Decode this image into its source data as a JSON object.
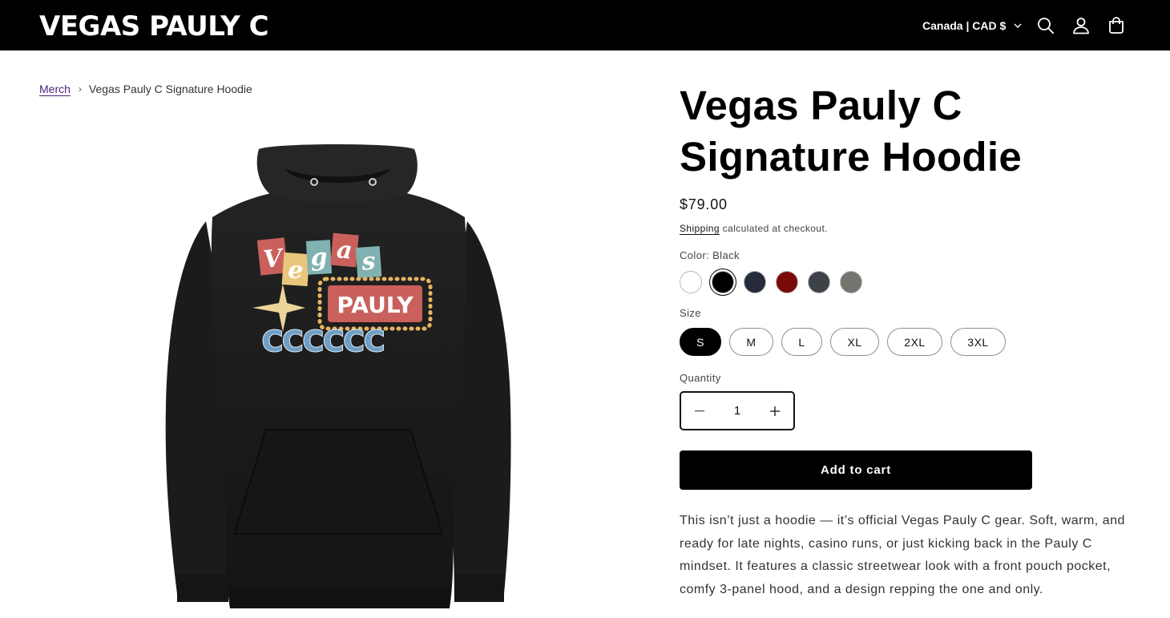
{
  "header": {
    "logo": "VEGAS PAULY C",
    "locale": "Canada | CAD $",
    "icons": [
      "search-icon",
      "account-icon",
      "cart-icon"
    ],
    "background": "#000000"
  },
  "breadcrumb": {
    "parent": "Merch",
    "separator": "›",
    "current": "Vegas Pauly C Signature Hoodie"
  },
  "product": {
    "title": "Vegas Pauly C Signature Hoodie",
    "price": "$79.00",
    "shipping_link": "Shipping",
    "shipping_rest": " calculated at checkout.",
    "color_label": "Color: Black",
    "colors": [
      {
        "name": "White",
        "hex": "#ffffff",
        "selected": false
      },
      {
        "name": "Black",
        "hex": "#000000",
        "selected": true
      },
      {
        "name": "Navy",
        "hex": "#262b3c",
        "selected": false
      },
      {
        "name": "Maroon",
        "hex": "#7a0a0a",
        "selected": false
      },
      {
        "name": "Charcoal",
        "hex": "#3d4249",
        "selected": false
      },
      {
        "name": "Grey",
        "hex": "#73756f",
        "selected": false
      }
    ],
    "size_label": "Size",
    "sizes": [
      {
        "label": "S",
        "selected": true
      },
      {
        "label": "M",
        "selected": false
      },
      {
        "label": "L",
        "selected": false
      },
      {
        "label": "XL",
        "selected": false
      },
      {
        "label": "2XL",
        "selected": false
      },
      {
        "label": "3XL",
        "selected": false
      }
    ],
    "quantity_label": "Quantity",
    "quantity_value": "1",
    "add_to_cart": "Add to cart",
    "description": "This isn’t just a hoodie — it’s official Vegas Pauly C gear. Soft, warm, and ready for late nights, casino runs, or just kicking back in the Pauly C mindset. It features a classic streetwear look with a front pouch pocket, comfy 3-panel hood, and a design repping the one and only."
  },
  "artwork": {
    "letters_top": [
      "V",
      "e",
      "g",
      "a",
      "s"
    ],
    "word_middle": "PAULY",
    "letters_bottom": "CCCCCC"
  }
}
